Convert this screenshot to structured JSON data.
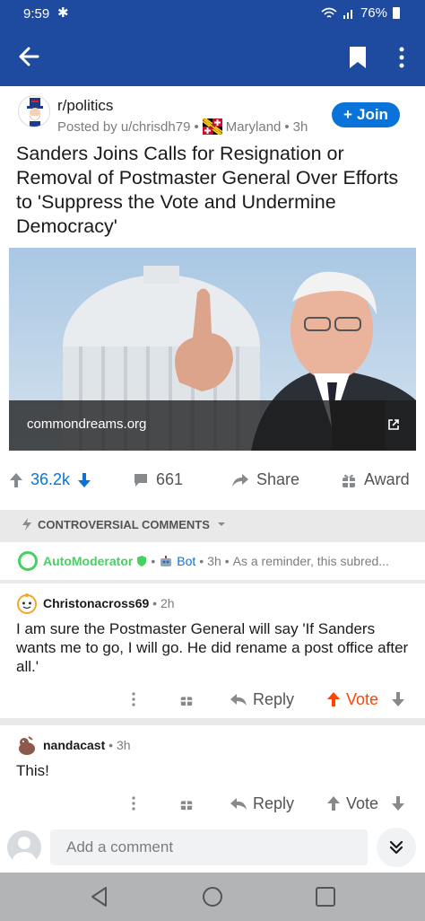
{
  "status": {
    "time": "9:59",
    "battery": "76%"
  },
  "post": {
    "subreddit": "r/politics",
    "posted_by": "Posted by u/chrisdh79",
    "flair": "Maryland",
    "age": "3h",
    "join_label": "Join",
    "title": "Sanders Joins Calls for Resignation or Removal of Postmaster General Over Efforts to 'Suppress the Vote and Undermine Democracy'",
    "link_domain": "commondreams.org",
    "score": "36.2k",
    "comments_count": "661",
    "share_label": "Share",
    "award_label": "Award"
  },
  "sort": {
    "label": "CONTROVERSIAL COMMENTS"
  },
  "automod": {
    "user": "AutoModerator",
    "bot_label": "Bot",
    "age": "3h",
    "preview": "As a reminder, this subred..."
  },
  "comments": [
    {
      "user": "Christonacross69",
      "age": "2h",
      "body": "I am sure the Postmaster General will say 'If Sanders wants me to go, I will go.  He did rename a post office after all.'",
      "reply_label": "Reply",
      "vote_label": "Vote",
      "upvoted": true
    },
    {
      "user": "nandacast",
      "age": "3h",
      "body": "This!",
      "reply_label": "Reply",
      "vote_label": "Vote",
      "upvoted": false
    }
  ],
  "comment_input": {
    "placeholder": "Add a comment"
  },
  "colors": {
    "header": "#1e4aa0",
    "join": "#0a73d9",
    "upvote": "#ff4500",
    "score": "#0a73d9",
    "mod": "#46d160"
  },
  "icons": [
    "back-icon",
    "bookmark-icon",
    "more-icon",
    "join-plus-icon",
    "upvote-icon",
    "downvote-icon",
    "comment-icon",
    "share-icon",
    "award-icon",
    "bolt-icon",
    "chevron-down-icon",
    "shield-icon",
    "robot-icon",
    "reply-icon",
    "overflow-icon",
    "double-chevron-icon"
  ]
}
